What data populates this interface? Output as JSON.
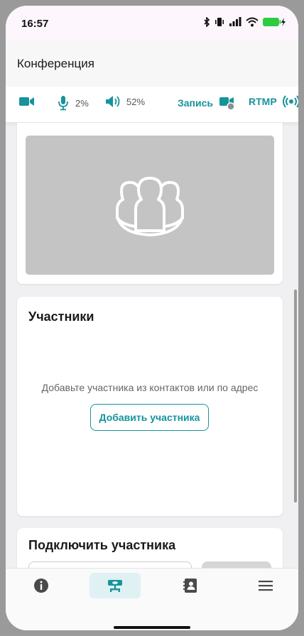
{
  "status_bar": {
    "time": "16:57"
  },
  "header": {
    "title": "Конференция"
  },
  "toolbar": {
    "mic_level": "2%",
    "volume_level": "52%",
    "record_label": "Запись",
    "rtmp_label": "RTMP"
  },
  "participants": {
    "title": "Участники",
    "hint": "Добавьте участника из контактов или по адрес",
    "add_button": "Добавить участника"
  },
  "connect": {
    "title": "Подключить участника",
    "input_placeholder": ""
  },
  "bottom_nav": {
    "items": [
      {
        "icon": "info-icon",
        "active": false
      },
      {
        "icon": "conference-icon",
        "active": true
      },
      {
        "icon": "contacts-icon",
        "active": false
      },
      {
        "icon": "menu-icon",
        "active": false
      }
    ]
  },
  "colors": {
    "accent": "#17939b",
    "active_tab_bg": "#dff1f3"
  }
}
